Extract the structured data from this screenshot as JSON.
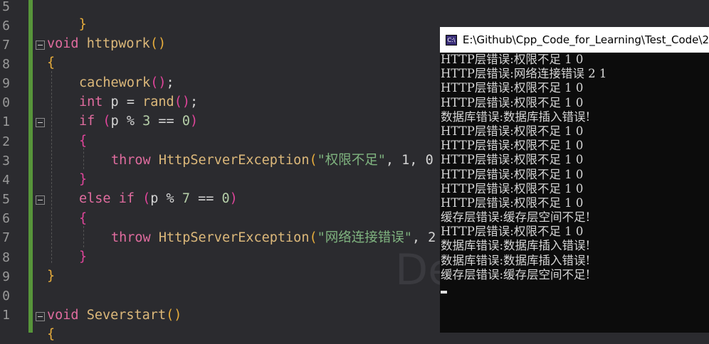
{
  "editor": {
    "line_numbers": [
      "5",
      "6",
      "7",
      "8",
      "9",
      "0",
      "1",
      "2",
      "3",
      "4",
      "5",
      "6",
      "7",
      "8",
      "9",
      "0",
      "1"
    ],
    "code": {
      "l0_brace": "}",
      "l2_kw": "void",
      "l2_fn": "httpwork",
      "l2_paren": "()",
      "l3_brace": "{",
      "l4_fn": "cachework",
      "l4_paren": "()",
      "l4_semi": ";",
      "l5_type": "int",
      "l5_rest": " p = ",
      "l5_fn": "rand",
      "l5_paren": "()",
      "l5_semi": ";",
      "l6_kw": "if",
      "l6_open": " (",
      "l6_expr": "p % ",
      "l6_num": "3",
      "l6_op": " == ",
      "l6_zero": "0",
      "l6_close": ")",
      "l7_brace": "{",
      "l8_kw": "throw",
      "l8_cls": " HttpServerException",
      "l8_open": "(",
      "l8_str": "\"权限不足\"",
      "l8_rest": ", 1, 0",
      "l9_brace": "}",
      "l10_kw": "else if",
      "l10_open": " (",
      "l10_expr": "p % ",
      "l10_num": "7",
      "l10_op": " == ",
      "l10_zero": "0",
      "l10_close": ")",
      "l11_brace": "{",
      "l12_kw": "throw",
      "l12_cls": " HttpServerException",
      "l12_open": "(",
      "l12_str": "\"网络连接错误\"",
      "l12_rest": ", 2",
      "l13_brace": "}",
      "l14_brace": "}",
      "l16_kw": "void",
      "l16_fn": " Severstart",
      "l16_paren": "()",
      "l17_brace": "{"
    },
    "watermark": "De"
  },
  "console": {
    "icon_label": "C:\\",
    "title": "E:\\Github\\Cpp_Code_for_Learning\\Test_Code\\2",
    "lines": [
      "HTTP层错误:权限不足 1 0",
      "HTTP层错误:网络连接错误 2 1",
      "HTTP层错误:权限不足 1 0",
      "HTTP层错误:权限不足 1 0",
      "数据库错误:数据库插入错误!",
      "HTTP层错误:权限不足 1 0",
      "HTTP层错误:权限不足 1 0",
      "HTTP层错误:权限不足 1 0",
      "HTTP层错误:权限不足 1 0",
      "HTTP层错误:权限不足 1 0",
      "HTTP层错误:权限不足 1 0",
      "缓存层错误:缓存层空间不足!",
      "HTTP层错误:权限不足 1 0",
      "数据库错误:数据库插入错误!",
      "数据库错误:数据库插入错误!",
      "缓存层错误:缓存层空间不足!"
    ]
  }
}
